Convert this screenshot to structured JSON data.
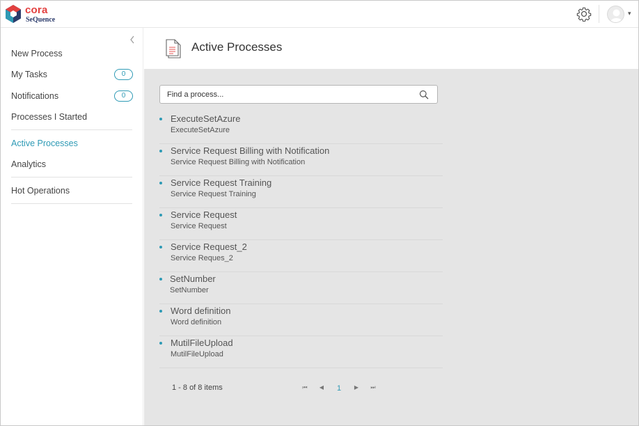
{
  "app": {
    "brand": "cora",
    "brand_sub": "SeQuence",
    "accent_color": "#2e9ab5",
    "brand_color": "#e2403f"
  },
  "header": {
    "settings_icon": "gear-icon",
    "user_icon": "avatar",
    "menu_caret": "▾"
  },
  "sidebar": {
    "collapse_icon": "chevron-left-icon",
    "items": [
      {
        "label": "New Process"
      },
      {
        "label": "My Tasks",
        "badge": "0"
      },
      {
        "label": "Notifications",
        "badge": "0"
      },
      {
        "label": "Processes I Started"
      },
      {
        "label": "Active Processes",
        "active": true
      },
      {
        "label": "Analytics"
      },
      {
        "label": "Hot Operations"
      }
    ]
  },
  "main": {
    "title": "Active Processes",
    "page_icon": "document-icon",
    "search": {
      "placeholder": "Find a process...",
      "value": ""
    },
    "processes": [
      {
        "name": "ExecuteSetAzure",
        "description": "ExecuteSetAzure"
      },
      {
        "name": "Service Request Billing with Notification",
        "description": "Service Request Billing with Notification"
      },
      {
        "name": "Service Request Training",
        "description": "Service Request Training"
      },
      {
        "name": "Service Request",
        "description": "Service Request"
      },
      {
        "name": "Service Request_2",
        "description": "Service Reques_2"
      },
      {
        "name": "SetNumber",
        "description": "SetNumber"
      },
      {
        "name": "Word definition",
        "description": "Word definition"
      },
      {
        "name": "MutilFileUpload",
        "description": "MutilFileUpload"
      }
    ],
    "pager": {
      "info": "1 - 8 of 8 items",
      "first": "⏮",
      "prev": "◀",
      "current_page": "1",
      "next": "▶",
      "last": "⏭"
    }
  }
}
